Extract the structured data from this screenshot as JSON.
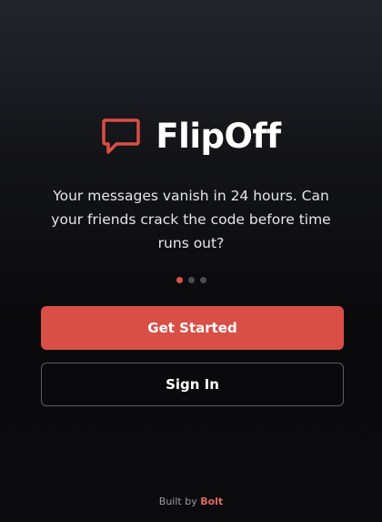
{
  "brand": {
    "name": "FlipOff",
    "icon": "speech-bubble-icon",
    "accent_color": "#d94e45"
  },
  "tagline": "Your messages vanish in 24 hours. Can your friends crack the code before time runs out?",
  "pagination": {
    "total": 3,
    "active_index": 0
  },
  "buttons": {
    "get_started_label": "Get Started",
    "sign_in_label": "Sign In"
  },
  "footer": {
    "prefix": "Built by",
    "link_label": "Bolt",
    "link_color": "#e0695f"
  }
}
